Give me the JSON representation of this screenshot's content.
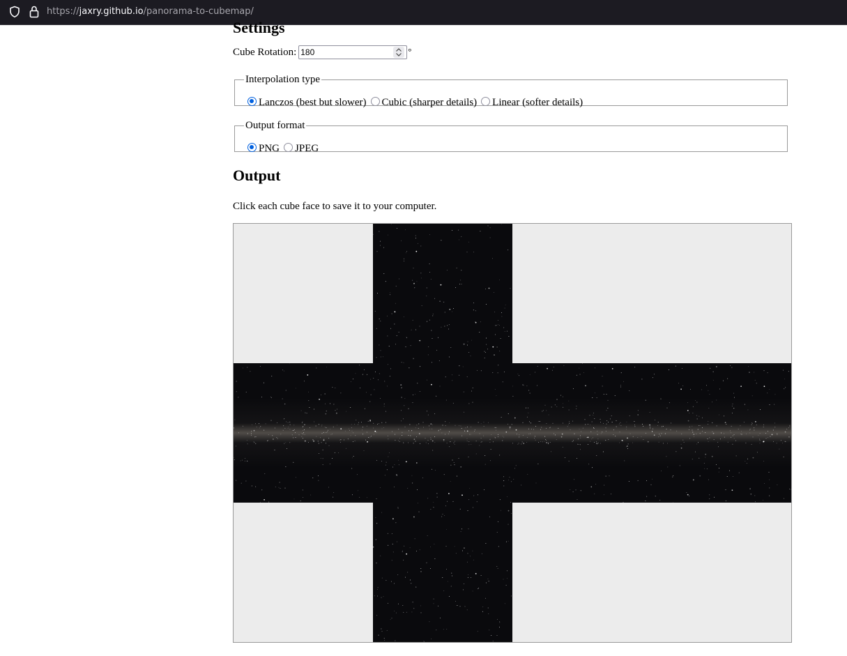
{
  "browser": {
    "url_prefix": "https://",
    "url_host": "jaxry.github.io",
    "url_path": "/panorama-to-cubemap/"
  },
  "settings": {
    "heading": "Settings",
    "rotation_label": "Cube Rotation:",
    "rotation_value": "180",
    "rotation_unit": "°"
  },
  "interpolation": {
    "legend": "Interpolation type",
    "options": [
      {
        "label": "Lanczos (best but slower)",
        "selected": true
      },
      {
        "label": "Cubic (sharper details)",
        "selected": false
      },
      {
        "label": "Linear (softer details)",
        "selected": false
      }
    ]
  },
  "format": {
    "legend": "Output format",
    "options": [
      {
        "label": "PNG",
        "selected": true
      },
      {
        "label": "JPEG",
        "selected": false
      }
    ]
  },
  "output": {
    "heading": "Output",
    "instruction": "Click each cube face to save it to your computer.",
    "faces": [
      "top",
      "left",
      "front",
      "right",
      "back",
      "bottom"
    ],
    "colors": {
      "space": "#0a0a0d",
      "empty_cell": "#ececec",
      "galactic_band": "#8a8278"
    }
  },
  "icons": {
    "site_info": "shield-icon",
    "connection": "lock-icon",
    "spinner": "spinner-arrows-icon"
  }
}
